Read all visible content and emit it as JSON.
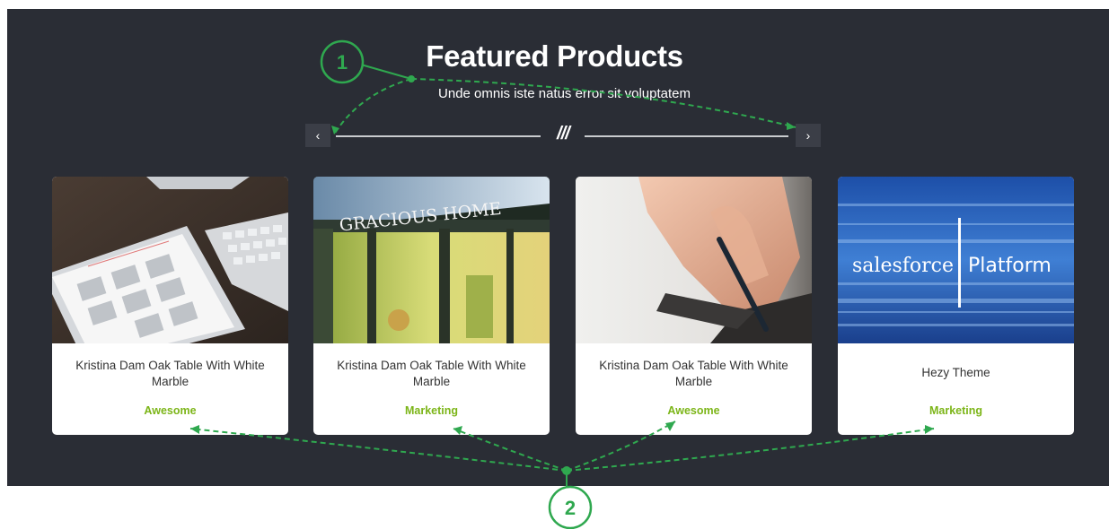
{
  "header": {
    "title": "Featured Products",
    "subtitle": "Unde omnis iste natus error sit voluptatem"
  },
  "carousel": {
    "prev_label": "‹",
    "next_label": "›",
    "divider_mark": "///"
  },
  "products": [
    {
      "title": "Kristina Dam Oak Table With White Marble",
      "tag": "Awesome"
    },
    {
      "title": "Kristina Dam Oak Table With White Marble",
      "tag": "Marketing",
      "sign_text": "GRACIOUS HOME"
    },
    {
      "title": "Kristina Dam Oak Table With White Marble",
      "tag": "Awesome"
    },
    {
      "title": "Hezy Theme",
      "tag": "Marketing",
      "logo_left": "salesforce",
      "logo_right": "Platform"
    }
  ],
  "annotations": {
    "badge_1": "1",
    "badge_2": "2",
    "color": "#2fa84f"
  },
  "colors": {
    "background": "#2a2d35",
    "tag_green": "#7cb518"
  }
}
